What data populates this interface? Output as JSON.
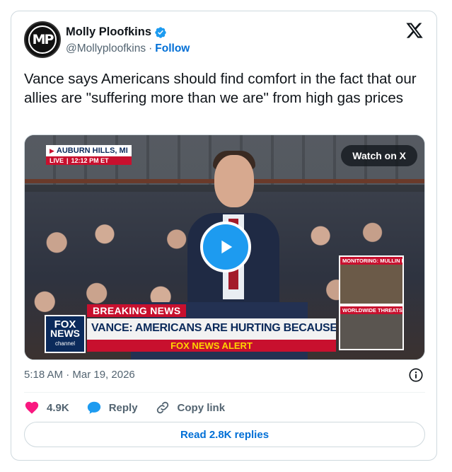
{
  "author": {
    "display_name": "Molly Ploofkins",
    "handle": "@Mollyploofkins",
    "separator": "·",
    "follow_label": "Follow",
    "avatar_initials": "MP",
    "verified": true
  },
  "tweet": {
    "text": "Vance says Americans should find comfort in the fact that our allies are \"suffering more than we are\" from high gas prices",
    "timestamp": "5:18 AM · Mar 19, 2026"
  },
  "media": {
    "watch_label": "Watch on X",
    "location": "AUBURN HILLS, MI",
    "live_label": "LIVE",
    "live_time": "12:12 PM ET",
    "monitor1_label": "MONITORING: MULLIN HEARING",
    "monitor2_label": "WORLDWIDE THREATS HEARING",
    "breaking_label": "BREAKING NEWS",
    "headline": "VANCE: AMERICANS ARE HURTING BECAUSE OF GAS PRICES",
    "alert_label": "FOX NEWS ALERT",
    "fox_logo_line1": "FOX",
    "fox_logo_line2": "NEWS",
    "fox_logo_line3": "channel"
  },
  "actions": {
    "like_count": "4.9K",
    "reply_label": "Reply",
    "copy_label": "Copy link",
    "read_replies_label": "Read 2.8K replies"
  },
  "colors": {
    "accent": "#006fd6",
    "like": "#f91880",
    "play": "#1d9bf0",
    "fox_red": "#c8102e",
    "fox_navy": "#0b2a5b"
  },
  "icons": {
    "verified": "verified-badge-icon",
    "x_logo": "x-logo-icon",
    "play": "play-icon",
    "info": "info-icon",
    "heart": "heart-icon",
    "reply": "speech-bubble-icon",
    "link": "link-icon"
  }
}
